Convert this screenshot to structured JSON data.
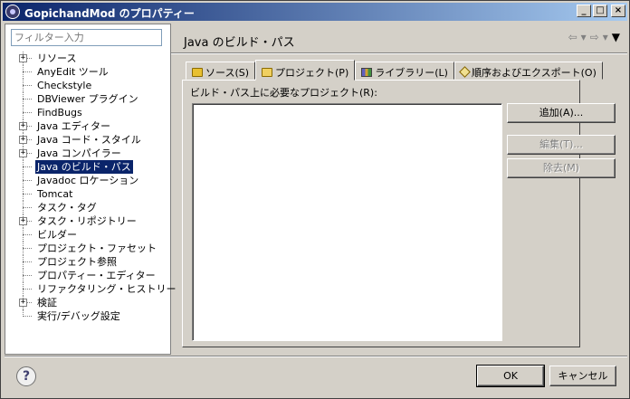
{
  "window": {
    "title": "GopichandMod のプロパティー",
    "controls": {
      "minimize": "_",
      "maximize": "□",
      "close": "×"
    }
  },
  "filter": {
    "placeholder": "フィルター入力"
  },
  "tree": [
    {
      "label": "リソース",
      "expandable": true
    },
    {
      "label": "AnyEdit ツール",
      "expandable": false
    },
    {
      "label": "Checkstyle",
      "expandable": false
    },
    {
      "label": "DBViewer プラグイン",
      "expandable": false
    },
    {
      "label": "FindBugs",
      "expandable": false
    },
    {
      "label": "Java エディター",
      "expandable": true
    },
    {
      "label": "Java コード・スタイル",
      "expandable": true
    },
    {
      "label": "Java コンパイラー",
      "expandable": true
    },
    {
      "label": "Java のビルド・パス",
      "expandable": false,
      "selected": true
    },
    {
      "label": "Javadoc ロケーション",
      "expandable": false
    },
    {
      "label": "Tomcat",
      "expandable": false
    },
    {
      "label": "タスク・タグ",
      "expandable": false
    },
    {
      "label": "タスク・リポジトリー",
      "expandable": true
    },
    {
      "label": "ビルダー",
      "expandable": false
    },
    {
      "label": "プロジェクト・ファセット",
      "expandable": false
    },
    {
      "label": "プロジェクト参照",
      "expandable": false
    },
    {
      "label": "プロパティー・エディター",
      "expandable": false
    },
    {
      "label": "リファクタリング・ヒストリー",
      "expandable": false
    },
    {
      "label": "検証",
      "expandable": true
    },
    {
      "label": "実行/デバッグ設定",
      "expandable": false
    }
  ],
  "page": {
    "title": "Java のビルド・パス",
    "nav": {
      "back": "⇦",
      "forward": "⇨",
      "dropdown": "▾",
      "menu": "▼"
    }
  },
  "tabs": [
    {
      "label": "ソース(S)",
      "icon": "source-folder-icon",
      "active": false
    },
    {
      "label": "プロジェクト(P)",
      "icon": "project-folder-icon",
      "active": true
    },
    {
      "label": "ライブラリー(L)",
      "icon": "library-icon",
      "active": false
    },
    {
      "label": "順序およびエクスポート(O)",
      "icon": "order-export-icon",
      "active": false
    }
  ],
  "content": {
    "label": "ビルド・パス上に必要なプロジェクト(R):",
    "buttons": {
      "add": "追加(A)...",
      "edit": "編集(T)...",
      "remove": "除去(M)"
    }
  },
  "dialog": {
    "help": "?",
    "ok": "OK",
    "cancel": "キャンセル"
  }
}
